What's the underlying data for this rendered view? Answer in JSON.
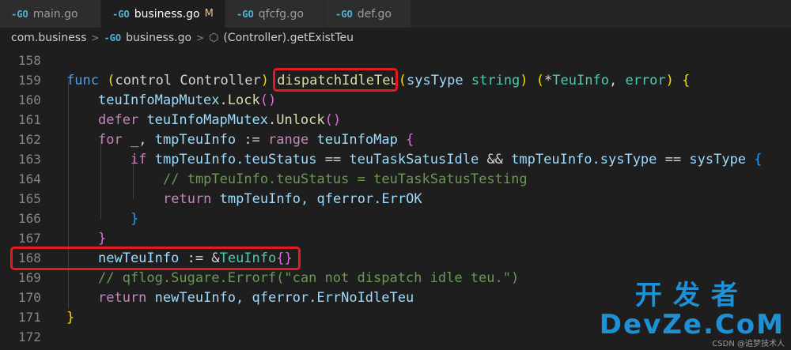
{
  "tabs": [
    {
      "icon": "go-icon",
      "label": "main.go",
      "modified": "",
      "active": false
    },
    {
      "icon": "go-icon",
      "label": "business.go",
      "modified": "M",
      "active": true
    },
    {
      "icon": "go-icon",
      "label": "qfcfg.go",
      "modified": "",
      "active": false
    },
    {
      "icon": "go-icon",
      "label": "def.go",
      "modified": "",
      "active": false
    }
  ],
  "breadcrumb": {
    "folder": "com.business",
    "file": "business.go",
    "symbol": "(Controller).getExistTeu"
  },
  "lines": [
    {
      "num": "158"
    },
    {
      "num": "159"
    },
    {
      "num": "160"
    },
    {
      "num": "161"
    },
    {
      "num": "162"
    },
    {
      "num": "163"
    },
    {
      "num": "164"
    },
    {
      "num": "165"
    },
    {
      "num": "166"
    },
    {
      "num": "167"
    },
    {
      "num": "168"
    },
    {
      "num": "169"
    },
    {
      "num": "170"
    },
    {
      "num": "171"
    },
    {
      "num": "172"
    }
  ],
  "code": {
    "l159": {
      "func": "func",
      "recv_open": "(",
      "recv": "control Controller",
      "recv_close": ")",
      "name": "dispatchIdleTeu",
      "p_open": "(",
      "param": "sysType",
      "param_type": "string",
      "p_close": ")",
      "r_open": "(",
      "r_star": "*",
      "r_type": "TeuInfo",
      "r_comma": ",",
      "r_err": "error",
      "r_close": ")",
      "brace": "{"
    },
    "l160": {
      "obj": "teuInfoMapMutex",
      "dot": ".",
      "method": "Lock",
      "parens": "()"
    },
    "l161": {
      "kw": "defer",
      "obj": "teuInfoMapMutex",
      "dot": ".",
      "method": "Unlock",
      "parens": "()"
    },
    "l162": {
      "kw": "for",
      "blank": "_,",
      "var": "tmpTeuInfo",
      "op": ":=",
      "range": "range",
      "map": "teuInfoMap",
      "brace": "{"
    },
    "l163": {
      "kw": "if",
      "lhs": "tmpTeuInfo.teuStatus",
      "eq": "==",
      "const": "teuTaskSatusIdle",
      "and": "&&",
      "lhs2": "tmpTeuInfo.sysType",
      "eq2": "==",
      "rhs2": "sysType",
      "brace": "{"
    },
    "l164": {
      "comment": "// tmpTeuInfo.teuStatus = teuTaskSatusTesting"
    },
    "l165": {
      "kw": "return",
      "val": "tmpTeuInfo,",
      "pkg": "qferror.ErrOK"
    },
    "l166": {
      "brace": "}"
    },
    "l167": {
      "brace": "}"
    },
    "l168": {
      "var": "newTeuInfo",
      "op": ":=",
      "amp": "&",
      "type": "TeuInfo",
      "braces": "{}"
    },
    "l169": {
      "comment": "// qflog.Sugare.Errorf(\"can not dispatch idle teu.\")"
    },
    "l170": {
      "kw": "return",
      "val": "newTeuInfo,",
      "pkg": "qferror.ErrNoIdleTeu"
    },
    "l171": {
      "brace": "}"
    }
  },
  "watermark": {
    "cn": "开发者",
    "en": "DevZe.CoM",
    "small": "CSDN @追梦技术人"
  }
}
